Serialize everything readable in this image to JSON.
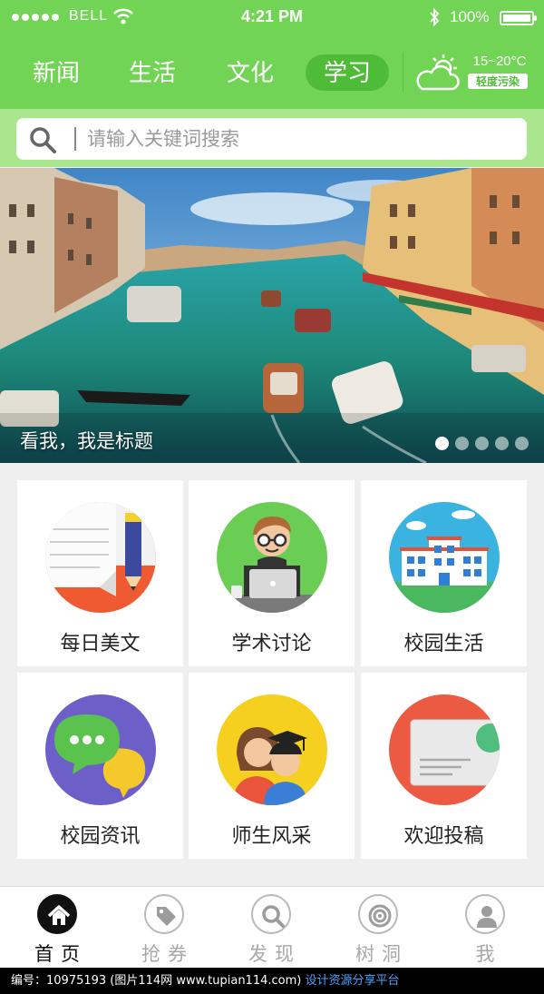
{
  "status_bar": {
    "carrier": "BELL",
    "time": "4:21 PM",
    "battery": "100%"
  },
  "nav": {
    "tabs": [
      {
        "label": "新闻",
        "active": false
      },
      {
        "label": "生活",
        "active": false
      },
      {
        "label": "文化",
        "active": false
      },
      {
        "label": "学习",
        "active": true
      }
    ],
    "weather": {
      "temp": "15~20°C",
      "air": "轻度污染",
      "icon": "partly-cloudy-icon"
    }
  },
  "search": {
    "placeholder": "请输入关键词搜索",
    "value": ""
  },
  "banner": {
    "caption": "看我，我是标题",
    "slides": 5,
    "current_slide": 1
  },
  "features": [
    {
      "label": "每日美文",
      "icon": "article-icon"
    },
    {
      "label": "学术讨论",
      "icon": "discussion-icon"
    },
    {
      "label": "校园生活",
      "icon": "campus-icon"
    },
    {
      "label": "校园资讯",
      "icon": "news-icon"
    },
    {
      "label": "师生风采",
      "icon": "teacher-student-icon"
    },
    {
      "label": "欢迎投稿",
      "icon": "submit-icon"
    }
  ],
  "tabbar": [
    {
      "label": "首页",
      "icon": "home-icon",
      "active": true
    },
    {
      "label": "抢券",
      "icon": "coupon-icon",
      "active": false
    },
    {
      "label": "发现",
      "icon": "discover-icon",
      "active": false
    },
    {
      "label": "树洞",
      "icon": "treehole-icon",
      "active": false
    },
    {
      "label": "我",
      "icon": "profile-icon",
      "active": false
    }
  ],
  "watermark": {
    "text": "编号：10975193 (图片114网 www.tupian114.com)",
    "link": "设计资源分享平台"
  },
  "colors": {
    "brand_green": "#72d455",
    "active_tab_bg": "#4ebc36",
    "search_bg": "#a9e68e"
  }
}
